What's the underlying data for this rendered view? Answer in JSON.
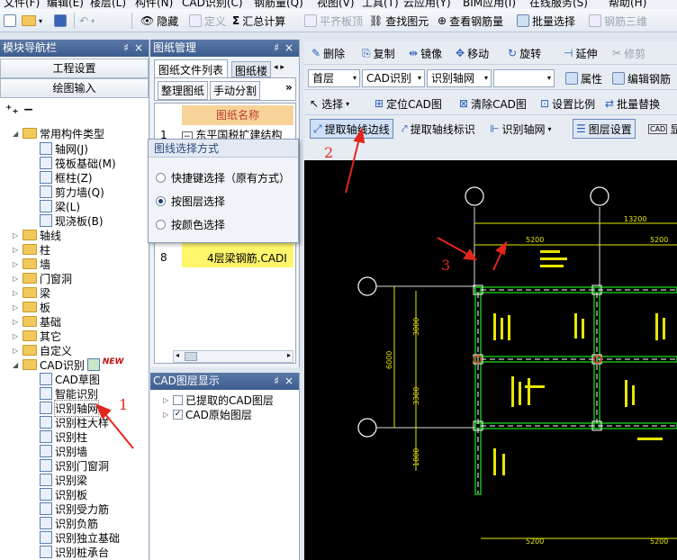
{
  "menu": [
    "文件(F)",
    "编辑(E)",
    "楼层(L)",
    "构件(N)",
    "CAD识别(C)",
    "钢筋量(Q)",
    "视图(V)",
    "工具(T)",
    "云应用(Y)",
    "BIM应用(I)",
    "在线服务(S)",
    "帮助(H)"
  ],
  "toolbar1": {
    "hide": "隐藏",
    "define": "定义",
    "sum": "汇总计算",
    "level_plate": "平齐板顶",
    "find": "查找图元",
    "view_rebar": "查看钢筋量",
    "batch_select": "批量选择",
    "rebar_3d": "钢筋三维",
    "sigma": "Σ"
  },
  "toolbar2": {
    "delete": "删除",
    "copy": "复制",
    "mirror": "镜像",
    "move": "移动",
    "rotate": "旋转",
    "extend": "延伸",
    "trim": "修剪"
  },
  "toolbar3": {
    "floor": "首层",
    "cad_recog": "CAD识别",
    "recog_axis": "识别轴网",
    "property": "属性",
    "edit_rebar": "编辑钢筋"
  },
  "toolbar4": {
    "select": "选择",
    "locate_cad": "定位CAD图",
    "clear_cad": "清除CAD图",
    "set_scale": "设置比例",
    "batch_replace": "批量替换"
  },
  "toolbar5": {
    "extract_axis_edge": "提取轴线边线",
    "extract_axis_label": "提取轴线标识",
    "recog_axis": "识别轴网",
    "layer_settings": "图层设置",
    "cad_short": "CAD",
    "show": "显"
  },
  "nav": {
    "title": "模块导航栏",
    "project_settings": "工程设置",
    "drawing_input": "绘图输入",
    "common_types": "常用构件类型",
    "common_items": [
      "轴网(J)",
      "筏板基础(M)",
      "框柱(Z)",
      "剪力墙(Q)",
      "梁(L)",
      "现浇板(B)"
    ],
    "folders": [
      "轴线",
      "柱",
      "墙",
      "门窗洞",
      "梁",
      "板",
      "基础",
      "其它",
      "自定义"
    ],
    "cad_recog": "CAD识别",
    "new_badge": "NEW",
    "cad_items": [
      "CAD草图",
      "智能识别",
      "识别轴网",
      "识别柱大样",
      "识别柱",
      "识别墙",
      "识别门窗洞",
      "识别梁",
      "识别板",
      "识别受力筋",
      "识别负筋",
      "识别独立基础",
      "识别桩承台"
    ]
  },
  "drawing_mgr": {
    "title": "图纸管理",
    "tab_files": "图纸文件列表",
    "tab_floor": "图纸楼",
    "btn_tidy": "整理图纸",
    "btn_split": "手动分割",
    "col_name": "图纸名称",
    "row1_no": "1",
    "row1_name": "东平国税扩建结构",
    "row8_no": "8",
    "row8_name": "4层梁钢筋.CADI"
  },
  "popup": {
    "title": "图线选择方式",
    "opt1": "快捷键选择（原有方式）",
    "opt2": "按图层选择",
    "opt3": "按颜色选择"
  },
  "layer_panel": {
    "title": "CAD图层显示",
    "extracted": "已提取的CAD图层",
    "original": "CAD原始图层"
  },
  "annotations": {
    "a1": "1",
    "a2": "2",
    "a3": "3"
  },
  "cad": {
    "dim_13200_top": "13200",
    "dim_5200a": "5200",
    "dim_5200b": "5200",
    "dim_3000": "3000",
    "dim_6000": "6000",
    "dim_3300": "3300",
    "dim_1800": "1800",
    "dim_5200_bottom_a": "5200",
    "dim_5200_bottom_b": "5200"
  },
  "colors": {
    "accent": "#3d5d8f",
    "annotation": "#e2261c",
    "cad_green": "#18c818",
    "highlight": "#fff66b"
  }
}
